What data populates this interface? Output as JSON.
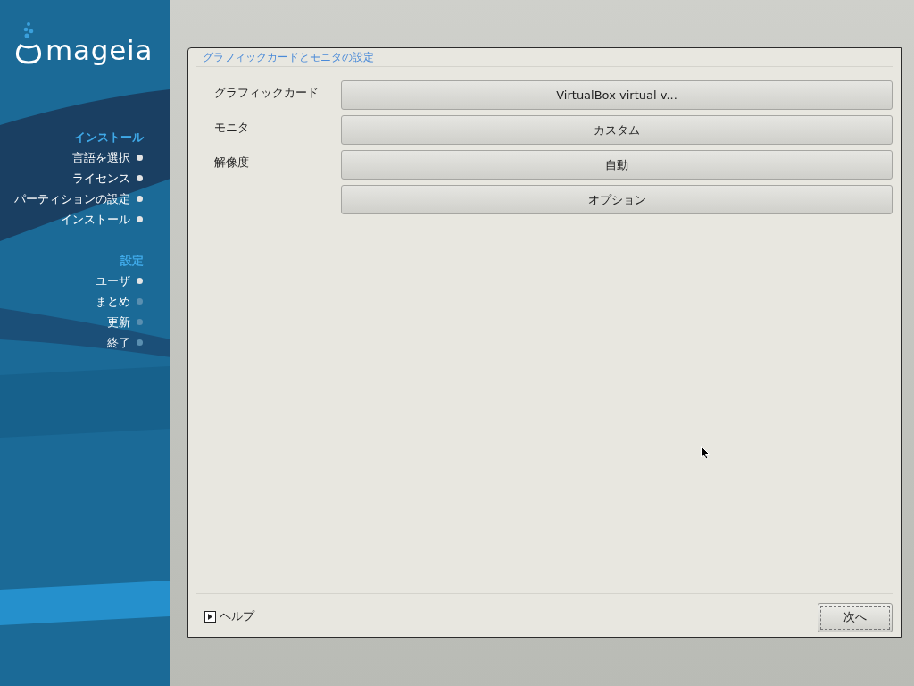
{
  "sidebar": {
    "logo": "mageia",
    "sections": [
      {
        "title": "インストール",
        "steps": [
          {
            "label": "言語を選択",
            "done": true
          },
          {
            "label": "ライセンス",
            "done": true
          },
          {
            "label": "パーティションの設定",
            "done": true
          },
          {
            "label": "インストール",
            "done": true
          }
        ]
      },
      {
        "title": "設定",
        "steps": [
          {
            "label": "ユーザ",
            "done": true
          },
          {
            "label": "まとめ",
            "done": false
          },
          {
            "label": "更新",
            "done": false
          },
          {
            "label": "終了",
            "done": false
          }
        ]
      }
    ]
  },
  "dialog": {
    "title": "グラフィックカードとモニタの設定",
    "rows": [
      {
        "label": "グラフィックカード",
        "button": "VirtualBox virtual v..."
      },
      {
        "label": "モニタ",
        "button": "カスタム"
      },
      {
        "label": "解像度",
        "button": "自動"
      },
      {
        "button": "オプション"
      }
    ],
    "help": {
      "label": "ヘルプ",
      "expanded": false
    },
    "next_button": "次へ"
  }
}
